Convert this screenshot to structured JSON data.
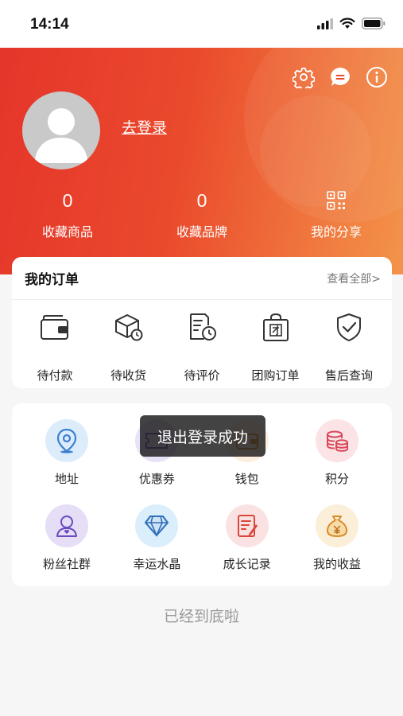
{
  "status": {
    "time": "14:14"
  },
  "profile": {
    "login_label": "去登录"
  },
  "stats": [
    {
      "value": "0",
      "label": "收藏商品"
    },
    {
      "value": "0",
      "label": "收藏品牌"
    },
    {
      "label": "我的分享"
    }
  ],
  "orders": {
    "title": "我的订单",
    "view_all": "查看全部>",
    "items": [
      {
        "label": "待付款",
        "icon": "wallet-icon"
      },
      {
        "label": "待收货",
        "icon": "package-icon"
      },
      {
        "label": "待评价",
        "icon": "review-icon"
      },
      {
        "label": "团购订单",
        "icon": "group-buy-icon"
      },
      {
        "label": "售后查询",
        "icon": "after-sales-icon"
      }
    ]
  },
  "services": [
    {
      "label": "地址",
      "icon": "location-icon"
    },
    {
      "label": "优惠券",
      "icon": "coupon-icon"
    },
    {
      "label": "钱包",
      "icon": "purse-icon"
    },
    {
      "label": "积分",
      "icon": "points-icon"
    },
    {
      "label": "粉丝社群",
      "icon": "fans-icon"
    },
    {
      "label": "幸运水晶",
      "icon": "crystal-icon"
    },
    {
      "label": "成长记录",
      "icon": "growth-record-icon"
    },
    {
      "label": "我的收益",
      "icon": "earnings-icon"
    }
  ],
  "toast": "退出登录成功",
  "footer": "已经到底啦",
  "colors": {
    "header_start": "#e5352b",
    "header_end": "#f3934a"
  }
}
